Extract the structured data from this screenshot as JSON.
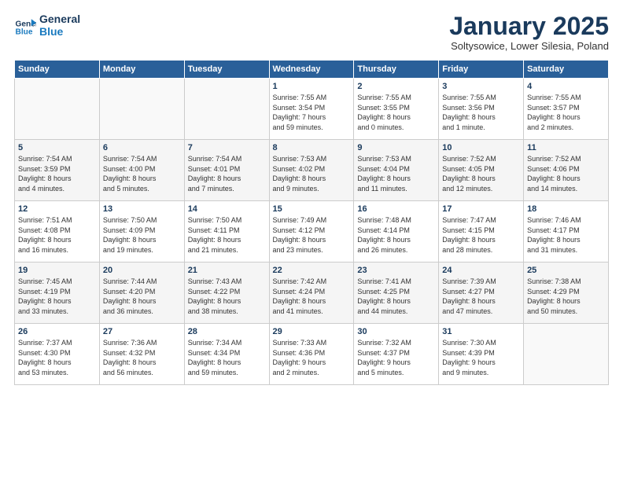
{
  "header": {
    "logo_line1": "General",
    "logo_line2": "Blue",
    "month_title": "January 2025",
    "location": "Soltysowice, Lower Silesia, Poland"
  },
  "weekdays": [
    "Sunday",
    "Monday",
    "Tuesday",
    "Wednesday",
    "Thursday",
    "Friday",
    "Saturday"
  ],
  "weeks": [
    [
      {
        "day": "",
        "info": ""
      },
      {
        "day": "",
        "info": ""
      },
      {
        "day": "",
        "info": ""
      },
      {
        "day": "1",
        "info": "Sunrise: 7:55 AM\nSunset: 3:54 PM\nDaylight: 7 hours\nand 59 minutes."
      },
      {
        "day": "2",
        "info": "Sunrise: 7:55 AM\nSunset: 3:55 PM\nDaylight: 8 hours\nand 0 minutes."
      },
      {
        "day": "3",
        "info": "Sunrise: 7:55 AM\nSunset: 3:56 PM\nDaylight: 8 hours\nand 1 minute."
      },
      {
        "day": "4",
        "info": "Sunrise: 7:55 AM\nSunset: 3:57 PM\nDaylight: 8 hours\nand 2 minutes."
      }
    ],
    [
      {
        "day": "5",
        "info": "Sunrise: 7:54 AM\nSunset: 3:59 PM\nDaylight: 8 hours\nand 4 minutes."
      },
      {
        "day": "6",
        "info": "Sunrise: 7:54 AM\nSunset: 4:00 PM\nDaylight: 8 hours\nand 5 minutes."
      },
      {
        "day": "7",
        "info": "Sunrise: 7:54 AM\nSunset: 4:01 PM\nDaylight: 8 hours\nand 7 minutes."
      },
      {
        "day": "8",
        "info": "Sunrise: 7:53 AM\nSunset: 4:02 PM\nDaylight: 8 hours\nand 9 minutes."
      },
      {
        "day": "9",
        "info": "Sunrise: 7:53 AM\nSunset: 4:04 PM\nDaylight: 8 hours\nand 11 minutes."
      },
      {
        "day": "10",
        "info": "Sunrise: 7:52 AM\nSunset: 4:05 PM\nDaylight: 8 hours\nand 12 minutes."
      },
      {
        "day": "11",
        "info": "Sunrise: 7:52 AM\nSunset: 4:06 PM\nDaylight: 8 hours\nand 14 minutes."
      }
    ],
    [
      {
        "day": "12",
        "info": "Sunrise: 7:51 AM\nSunset: 4:08 PM\nDaylight: 8 hours\nand 16 minutes."
      },
      {
        "day": "13",
        "info": "Sunrise: 7:50 AM\nSunset: 4:09 PM\nDaylight: 8 hours\nand 19 minutes."
      },
      {
        "day": "14",
        "info": "Sunrise: 7:50 AM\nSunset: 4:11 PM\nDaylight: 8 hours\nand 21 minutes."
      },
      {
        "day": "15",
        "info": "Sunrise: 7:49 AM\nSunset: 4:12 PM\nDaylight: 8 hours\nand 23 minutes."
      },
      {
        "day": "16",
        "info": "Sunrise: 7:48 AM\nSunset: 4:14 PM\nDaylight: 8 hours\nand 26 minutes."
      },
      {
        "day": "17",
        "info": "Sunrise: 7:47 AM\nSunset: 4:15 PM\nDaylight: 8 hours\nand 28 minutes."
      },
      {
        "day": "18",
        "info": "Sunrise: 7:46 AM\nSunset: 4:17 PM\nDaylight: 8 hours\nand 31 minutes."
      }
    ],
    [
      {
        "day": "19",
        "info": "Sunrise: 7:45 AM\nSunset: 4:19 PM\nDaylight: 8 hours\nand 33 minutes."
      },
      {
        "day": "20",
        "info": "Sunrise: 7:44 AM\nSunset: 4:20 PM\nDaylight: 8 hours\nand 36 minutes."
      },
      {
        "day": "21",
        "info": "Sunrise: 7:43 AM\nSunset: 4:22 PM\nDaylight: 8 hours\nand 38 minutes."
      },
      {
        "day": "22",
        "info": "Sunrise: 7:42 AM\nSunset: 4:24 PM\nDaylight: 8 hours\nand 41 minutes."
      },
      {
        "day": "23",
        "info": "Sunrise: 7:41 AM\nSunset: 4:25 PM\nDaylight: 8 hours\nand 44 minutes."
      },
      {
        "day": "24",
        "info": "Sunrise: 7:39 AM\nSunset: 4:27 PM\nDaylight: 8 hours\nand 47 minutes."
      },
      {
        "day": "25",
        "info": "Sunrise: 7:38 AM\nSunset: 4:29 PM\nDaylight: 8 hours\nand 50 minutes."
      }
    ],
    [
      {
        "day": "26",
        "info": "Sunrise: 7:37 AM\nSunset: 4:30 PM\nDaylight: 8 hours\nand 53 minutes."
      },
      {
        "day": "27",
        "info": "Sunrise: 7:36 AM\nSunset: 4:32 PM\nDaylight: 8 hours\nand 56 minutes."
      },
      {
        "day": "28",
        "info": "Sunrise: 7:34 AM\nSunset: 4:34 PM\nDaylight: 8 hours\nand 59 minutes."
      },
      {
        "day": "29",
        "info": "Sunrise: 7:33 AM\nSunset: 4:36 PM\nDaylight: 9 hours\nand 2 minutes."
      },
      {
        "day": "30",
        "info": "Sunrise: 7:32 AM\nSunset: 4:37 PM\nDaylight: 9 hours\nand 5 minutes."
      },
      {
        "day": "31",
        "info": "Sunrise: 7:30 AM\nSunset: 4:39 PM\nDaylight: 9 hours\nand 9 minutes."
      },
      {
        "day": "",
        "info": ""
      }
    ]
  ]
}
